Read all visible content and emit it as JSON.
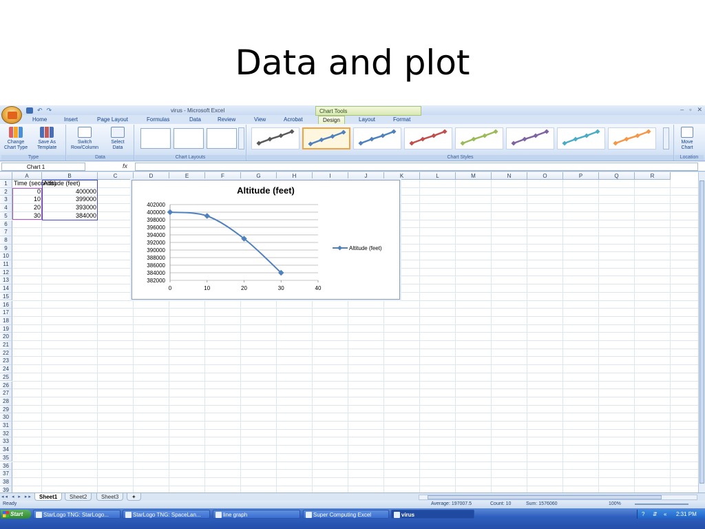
{
  "slide": {
    "title": "Data and plot"
  },
  "window": {
    "title": "virus - Microsoft Excel",
    "contextual_tab_group": "Chart Tools"
  },
  "ribbon_tabs": [
    "Home",
    "Insert",
    "Page Layout",
    "Formulas",
    "Data",
    "Review",
    "View",
    "Acrobat",
    "Design",
    "Layout",
    "Format"
  ],
  "active_tab": "Design",
  "ribbon": {
    "type_group": "Type",
    "change_chart_type": [
      "Change",
      "Chart Type"
    ],
    "save_as_template": [
      "Save As",
      "Template"
    ],
    "data_group": "Data",
    "switch_row_column": [
      "Switch",
      "Row/Column"
    ],
    "select_data": [
      "Select",
      "Data"
    ],
    "chart_layouts_group": "Chart Layouts",
    "chart_styles_group": "Chart Styles",
    "location_group": "Location",
    "move_chart": [
      "Move",
      "Chart"
    ],
    "style_colors": [
      "#595959",
      "#4f81bd",
      "#4f81bd",
      "#c0504d",
      "#9bbb59",
      "#8064a2",
      "#4bacc6",
      "#f79646"
    ]
  },
  "name_box": "Chart 1",
  "columns": [
    "A",
    "B",
    "C",
    "D",
    "E",
    "F",
    "G",
    "H",
    "I",
    "J",
    "K",
    "L",
    "M",
    "N",
    "O",
    "P",
    "Q",
    "R"
  ],
  "rows": [
    "1",
    "2",
    "3",
    "4",
    "5",
    "6",
    "7",
    "8",
    "9",
    "10",
    "11",
    "12",
    "13",
    "14",
    "15",
    "16",
    "17",
    "18",
    "19",
    "20",
    "21",
    "22",
    "23",
    "24",
    "25",
    "26",
    "27",
    "28",
    "29",
    "30",
    "31",
    "32",
    "33",
    "34",
    "35",
    "36",
    "37",
    "38",
    "39"
  ],
  "cells": {
    "A1": "Time (seconds)",
    "B1": "Altitude (feet)",
    "A2": "0",
    "B2": "400000",
    "A3": "10",
    "B3": "399000",
    "A4": "20",
    "B4": "393000",
    "A5": "30",
    "B5": "384000"
  },
  "chart_data": {
    "type": "scatter",
    "title": "Altitude (feet)",
    "xlabel": "",
    "ylabel": "",
    "x": [
      0,
      10,
      20,
      30
    ],
    "series": [
      {
        "name": "Altitude (feet)",
        "values": [
          400000,
          399000,
          393000,
          384000
        ]
      }
    ],
    "xlim": [
      0,
      40
    ],
    "ylim": [
      382000,
      402000
    ],
    "x_ticks": [
      "0",
      "10",
      "20",
      "30",
      "40"
    ],
    "y_ticks": [
      "402000",
      "400000",
      "398000",
      "396000",
      "394000",
      "392000",
      "390000",
      "388000",
      "386000",
      "384000",
      "382000"
    ],
    "grid": "horizontal",
    "legend": "right",
    "line_style": "smoothed line with markers",
    "series_color": "#4f81bd"
  },
  "sheets": [
    "Sheet1",
    "Sheet2",
    "Sheet3"
  ],
  "active_sheet": "Sheet1",
  "status": {
    "ready": "Ready",
    "average": "Average: 197007.5",
    "count": "Count: 10",
    "sum": "Sum: 1576060",
    "zoom": "100%"
  },
  "taskbar": {
    "start": "Start",
    "tasks": [
      "StarLogo TNG: StarLogo...",
      "StarLogo TNG: SpaceLan...",
      "line graph",
      "Super Computing Excel",
      "virus"
    ],
    "active_task": "virus",
    "clock": "2:31 PM"
  }
}
